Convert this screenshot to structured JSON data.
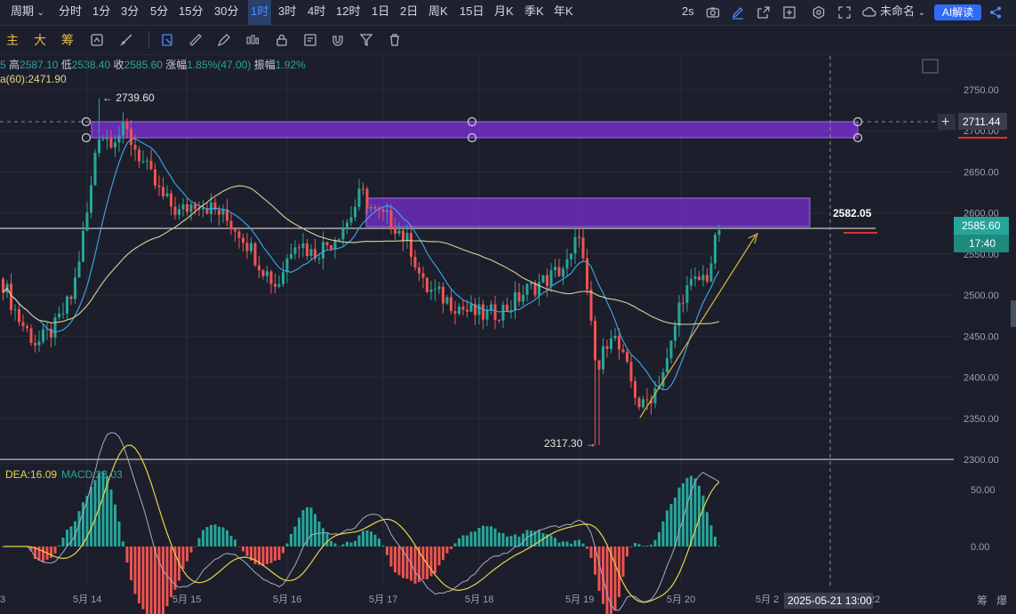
{
  "toolbar": {
    "cycle_label": "周期",
    "timeframes": [
      "分时",
      "1分",
      "3分",
      "5分",
      "15分",
      "30分",
      "1时",
      "3时",
      "4时",
      "12时",
      "1日",
      "2日",
      "周K",
      "15日",
      "月K",
      "季K",
      "年K"
    ],
    "active_timeframe": "1时",
    "refresh": "2s",
    "layout_name": "未命名",
    "ai_button": "AI解读"
  },
  "drawbar": {
    "labels": [
      "主",
      "大",
      "筹"
    ],
    "icons": [
      "indicator-template-icon",
      "line-tool-icon",
      "select-tool-icon",
      "ruler-icon",
      "pen-icon",
      "candle-style-icon",
      "lock-icon",
      "note-icon",
      "magnet-icon",
      "filter-icon",
      "trash-icon"
    ]
  },
  "info": {
    "open_partial": "5",
    "high_label": "高",
    "high": "2587.10",
    "low_label": "低",
    "low": "2538.40",
    "close_label": "收",
    "close": "2585.60",
    "change_label": "涨幅",
    "change": "1.85%(47.00)",
    "amp_label": "振幅",
    "amp": "1.92%",
    "ma_text": "a(60):2471.90"
  },
  "chart": {
    "price_axis": [
      "2750.00",
      "2700.00",
      "2650.00",
      "2600.00",
      "2550.00",
      "2500.00",
      "2450.00",
      "2400.00",
      "2350.00",
      "2300.00"
    ],
    "time_axis": [
      "3",
      "5月 14",
      "5月 15",
      "5月 16",
      "5月 17",
      "5月 18",
      "5月 19",
      "5月 20",
      "5月 2",
      "22"
    ],
    "crosshair_price": "2711.44",
    "crosshair_time": "2025-05-21 13:00",
    "last_price": "2585.60",
    "countdown": "17:40",
    "hline_label": "2582.05",
    "max_label": "← 2739.60",
    "min_label": "2317.30 →",
    "macd_axis": [
      "50.00",
      "0.00"
    ],
    "macd_dea": "DEA:16.09",
    "macd_value": "MACD:23.03",
    "corner_right": [
      "筹",
      "爆"
    ]
  },
  "colors": {
    "up": "#26a69a",
    "down": "#ef5350",
    "zone": "#7b2fd6",
    "ma_blue": "#3fa8f0",
    "ma_yellow": "#d9d39a",
    "accent": "#4b8cff"
  },
  "chart_data": {
    "type": "candlestick",
    "x": [
      "5月 14",
      "5月 15",
      "5月 16",
      "5月 17",
      "5月 18",
      "5月 19",
      "5月 20"
    ],
    "series": [
      {
        "name": "",
        "values": [
          [
            2490,
            2530,
            2480,
            2520
          ],
          [
            2520,
            2600,
            2515,
            2590
          ],
          [
            2590,
            2739.6,
            2580,
            2700
          ],
          [
            2700,
            2710,
            2650,
            2670
          ],
          [
            2670,
            2680,
            2600,
            2620
          ],
          [
            2620,
            2640,
            2590,
            2610
          ],
          [
            2610,
            2630,
            2580,
            2600
          ],
          [
            2600,
            2610,
            2560,
            2575
          ],
          [
            2575,
            2590,
            2520,
            2545
          ],
          [
            2545,
            2560,
            2480,
            2510
          ],
          [
            2510,
            2570,
            2500,
            2560
          ],
          [
            2560,
            2600,
            2550,
            2590
          ],
          [
            2590,
            2655,
            2580,
            2600
          ],
          [
            2600,
            2610,
            2565,
            2575
          ],
          [
            2575,
            2580,
            2480,
            2505
          ],
          [
            2505,
            2520,
            2470,
            2490
          ],
          [
            2490,
            2500,
            2460,
            2475
          ],
          [
            2475,
            2490,
            2450,
            2470
          ],
          [
            2470,
            2500,
            2460,
            2495
          ],
          [
            2495,
            2520,
            2480,
            2510
          ],
          [
            2510,
            2540,
            2500,
            2530
          ],
          [
            2530,
            2585,
            2520,
            2575
          ],
          [
            2575,
            2580,
            2480,
            2495
          ],
          [
            2495,
            2500,
            2380,
            2420
          ],
          [
            2420,
            2440,
            2317.3,
            2370
          ],
          [
            2370,
            2420,
            2360,
            2400
          ],
          [
            2400,
            2430,
            2380,
            2420
          ],
          [
            2420,
            2470,
            2410,
            2460
          ],
          [
            2460,
            2520,
            2450,
            2510
          ],
          [
            2510,
            2540,
            2490,
            2530
          ],
          [
            2530,
            2587.1,
            2520,
            2585.6
          ]
        ]
      }
    ],
    "ma": {
      "name": "MA(60)",
      "value": 2471.9
    },
    "ylim": [
      2290,
      2770
    ],
    "macd": {
      "dea": 16.09,
      "macd": 23.03,
      "ylim": [
        -40,
        70
      ]
    }
  }
}
